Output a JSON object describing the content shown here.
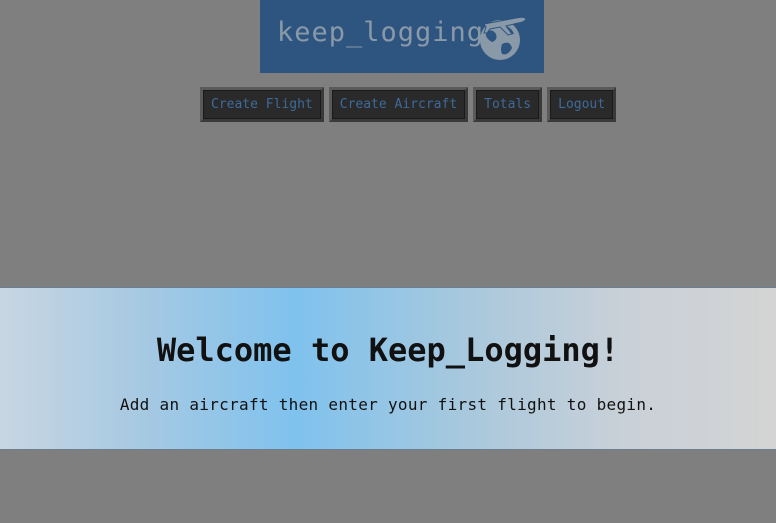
{
  "logo": {
    "text": "keep_logging",
    "icon": "globe-airplane-icon",
    "background": "#2d5580"
  },
  "nav": {
    "items": [
      {
        "label": "Create Flight"
      },
      {
        "label": "Create Aircraft"
      },
      {
        "label": "Totals"
      },
      {
        "label": "Logout"
      }
    ],
    "text_color": "#3e6a9a"
  },
  "hero": {
    "title": "Welcome to Keep_Logging!",
    "subtitle": "Add an aircraft then enter your first flight to begin."
  }
}
